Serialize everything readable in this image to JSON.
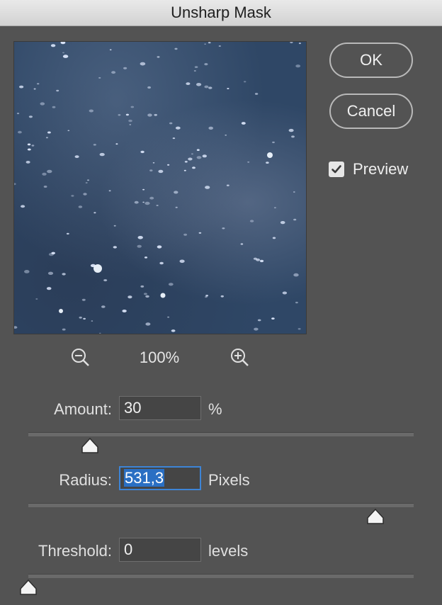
{
  "window": {
    "title": "Unsharp Mask"
  },
  "buttons": {
    "ok_label": "OK",
    "cancel_label": "Cancel"
  },
  "preview_toggle": {
    "label": "Preview",
    "checked": true
  },
  "zoom": {
    "level": "100%",
    "zoom_out_icon": "zoom-out-icon",
    "zoom_in_icon": "zoom-in-icon"
  },
  "params": {
    "amount": {
      "label": "Amount:",
      "value": "30",
      "unit": "%",
      "slider_fraction": 0.16
    },
    "radius": {
      "label": "Radius:",
      "value": "531,3",
      "unit": "Pixels",
      "slider_fraction": 0.9
    },
    "threshold": {
      "label": "Threshold:",
      "value": "0",
      "unit": "levels",
      "slider_fraction": 0.0
    }
  },
  "colors": {
    "dialog_bg": "#535353",
    "title_bg": "#dcdcdc",
    "focus_ring": "#3d84d6",
    "selection": "#2a6fc3",
    "preview_base": "#2f4766"
  }
}
